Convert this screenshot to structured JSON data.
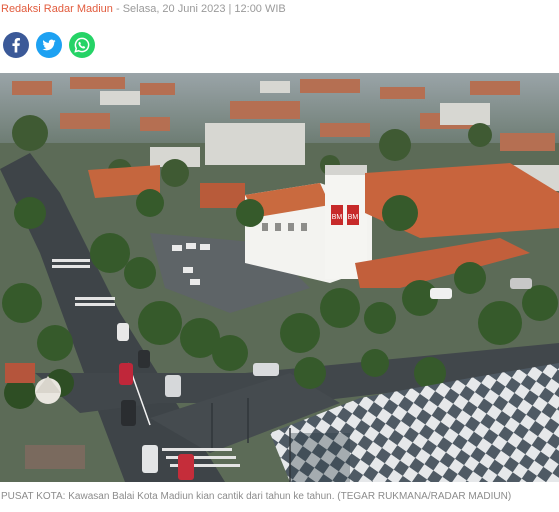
{
  "article": {
    "author": "Redaksi Radar Madiun",
    "separator": "-",
    "date": "Selasa, 20 Juni 2023 | 12:00 WIB"
  },
  "share": [
    {
      "name": "facebook",
      "icon": "facebook-icon",
      "color": "#3b5998"
    },
    {
      "name": "twitter",
      "icon": "twitter-icon",
      "color": "#1da1f2"
    },
    {
      "name": "whatsapp",
      "icon": "whatsapp-icon",
      "color": "#25d366"
    }
  ],
  "photo": {
    "sign_left": "BM",
    "sign_right": "BM"
  },
  "caption": "PUSAT KOTA: Kawasan Balai Kota Madiun kian cantik dari tahun ke tahun. (TEGAR RUKMANA/RADAR MADIUN)"
}
